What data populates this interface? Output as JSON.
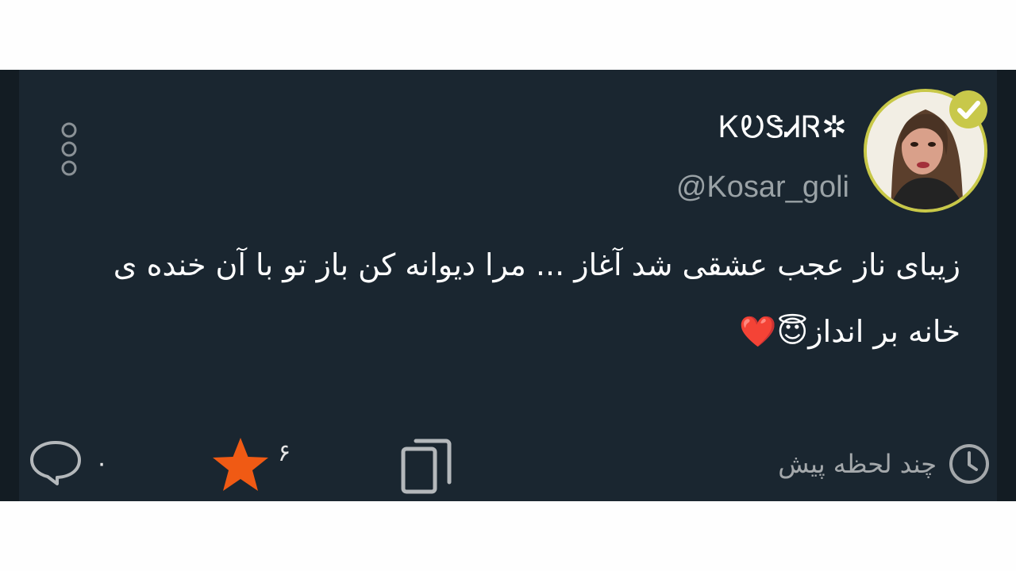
{
  "tweet": {
    "display_name": "ᏦᎧᏕᏗᏒ✲",
    "handle": "@Kosar_goli",
    "verified": true,
    "text": "زیبای ناز عجب عشقی شد آغاز ... مرا دیوانه کن باز تو با آن خنده ی خانه بر انداز😇❤️",
    "timestamp": "چند لحظه پیش",
    "replies": "۰",
    "favorites": "۶"
  },
  "icons": {
    "more": "more-vertical-icon",
    "reply": "speech-bubble-icon",
    "favorite": "star-icon",
    "copy": "copy-icon",
    "time": "clock-icon",
    "verified": "verified-check-icon"
  },
  "colors": {
    "background": "#1a2630",
    "star": "#f05a14",
    "verified_badge": "#c8c84a",
    "muted_text": "#9aa2a6"
  }
}
